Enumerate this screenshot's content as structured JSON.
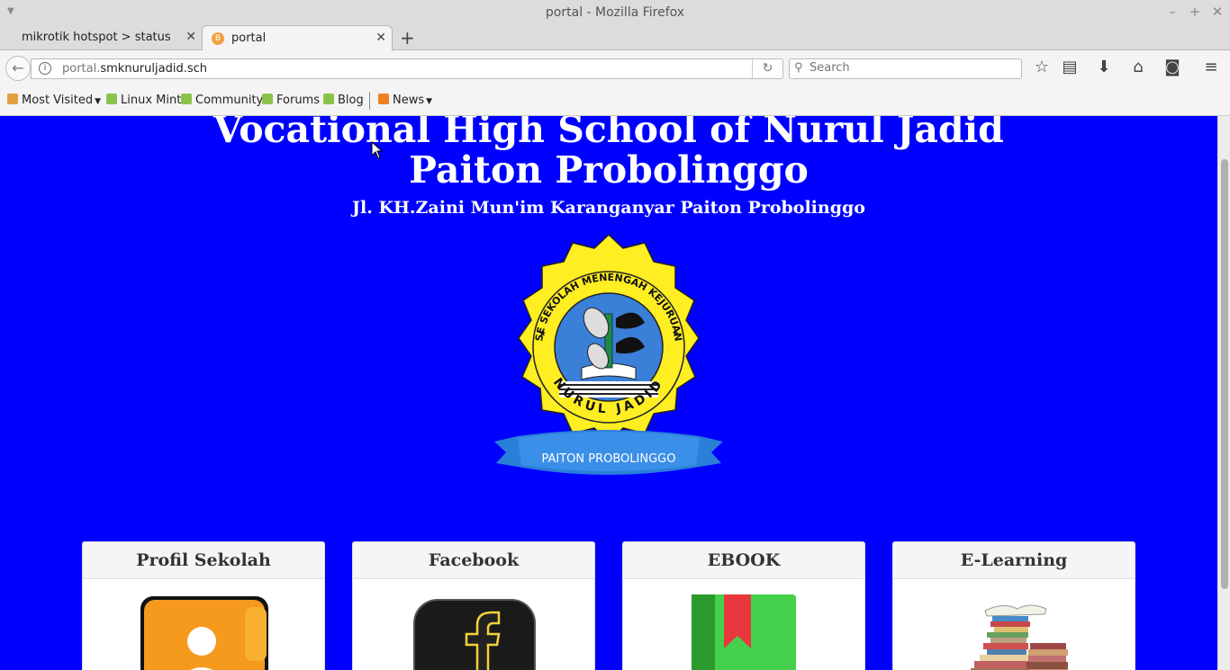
{
  "window": {
    "title": "portal - Mozilla Firefox"
  },
  "tabs": [
    {
      "label": "mikrotik hotspot > status"
    },
    {
      "label": "portal"
    }
  ],
  "navbar": {
    "url_dim": "portal.",
    "url_host": "smknuruljadid.sch",
    "search_placeholder": "Search"
  },
  "bookmarks": [
    {
      "label": "Most Visited"
    },
    {
      "label": "Linux Mint"
    },
    {
      "label": "Community"
    },
    {
      "label": "Forums"
    },
    {
      "label": "Blog"
    },
    {
      "label": "News"
    }
  ],
  "page": {
    "title_line1": "Vocational High School of Nurul Jadid",
    "title_line2": "Paiton Probolinggo",
    "address": "Jl. KH.Zaini Mun'im Karanganyar Paiton Probolinggo",
    "logo_text": {
      "ring": "SE SEKOLAH MENENGAH KEJURUAN",
      "name": "NURUL JADID",
      "banner": "PAITON PROBOLINGGO"
    },
    "background_color": "#0000ff",
    "cards": [
      {
        "title": "Profil Sekolah",
        "icon": "profile-icon"
      },
      {
        "title": "Facebook",
        "icon": "facebook-icon"
      },
      {
        "title": "EBOOK",
        "icon": "ebook-icon"
      },
      {
        "title": "E-Learning",
        "icon": "books-stack-icon"
      }
    ]
  }
}
